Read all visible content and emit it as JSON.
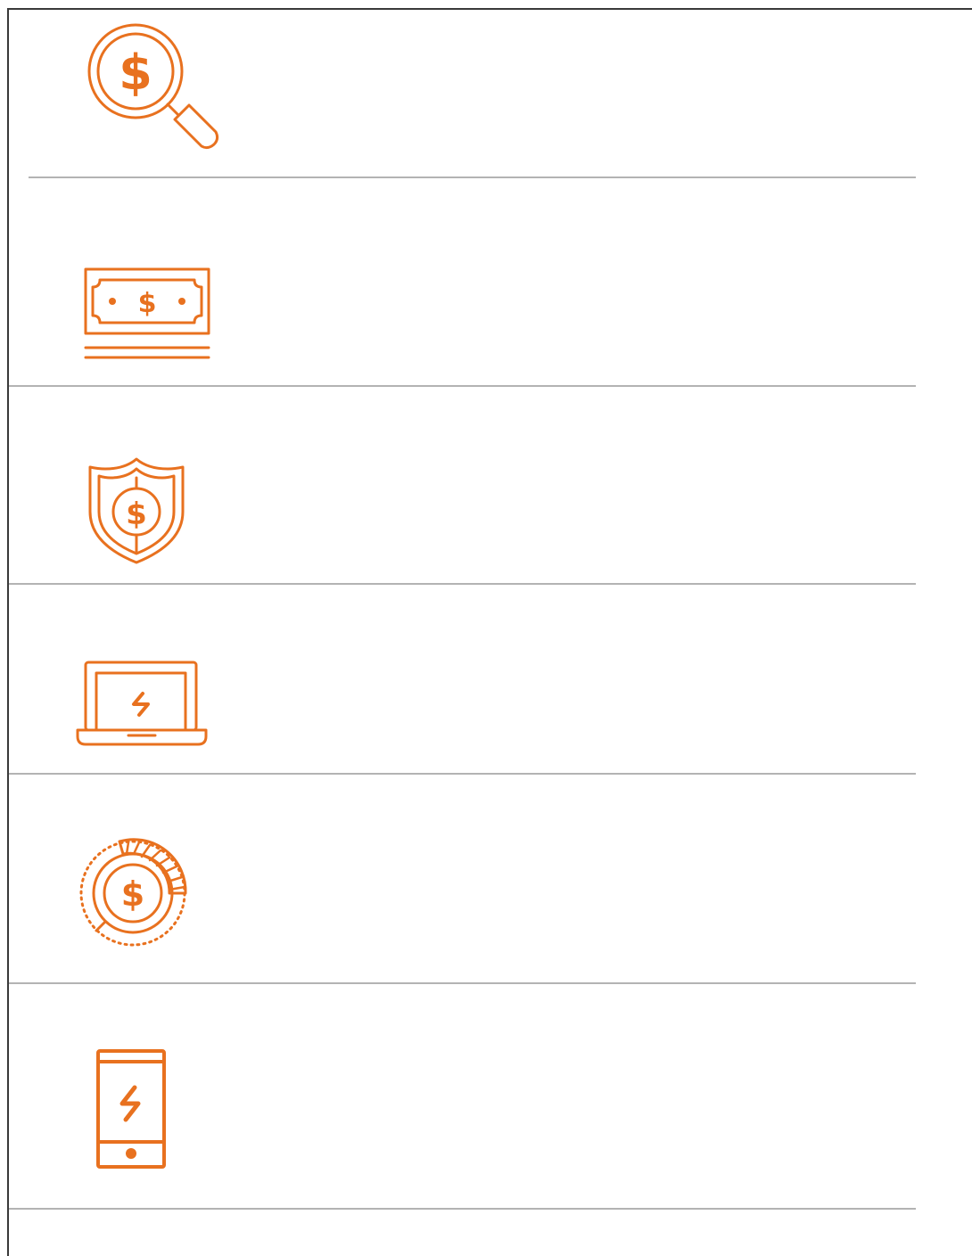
{
  "colors": {
    "accent": "#e8711f",
    "divider": "#b3b3b3",
    "frame": "#3a3a3a"
  },
  "rows": [
    {
      "icon": "dollar-search-icon",
      "glyph": "$"
    },
    {
      "icon": "banknote-stack-icon",
      "glyph": "$"
    },
    {
      "icon": "dollar-shield-icon",
      "glyph": "$"
    },
    {
      "icon": "laptop-lightning-icon"
    },
    {
      "icon": "dollar-coin-progress-icon",
      "glyph": "$"
    },
    {
      "icon": "smartphone-lightning-icon"
    }
  ]
}
